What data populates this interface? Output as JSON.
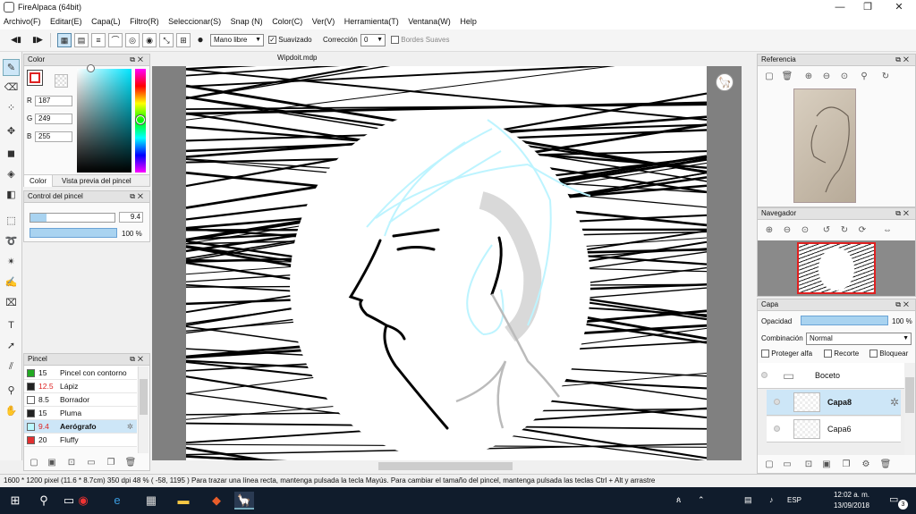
{
  "window": {
    "title": "FireAlpaca (64bit)",
    "minimize": "—",
    "restore": "❐",
    "close": "✕"
  },
  "menu": [
    "Archivo(F)",
    "Editar(E)",
    "Capa(L)",
    "Filtro(R)",
    "Seleccionar(S)",
    "Snap (N)",
    "Color(C)",
    "Ver(V)",
    "Herramienta(T)",
    "Ventana(W)",
    "Help"
  ],
  "toolbar": {
    "brush_mode": "Mano libre",
    "smoothing_label": "Suavizado",
    "correction_label": "Corrección",
    "correction_value": "0",
    "soft_edges_label": "Bordes Suaves"
  },
  "color_panel": {
    "title": "Color",
    "r_label": "R",
    "r_value": "187",
    "g_label": "G",
    "g_value": "249",
    "b_label": "B",
    "b_value": "255",
    "tab_color": "Color",
    "tab_preview": "Vista previa del pincel",
    "fg_color": "#bbf9ff"
  },
  "brush_control": {
    "title": "Control del pincel",
    "size_value": "9.4",
    "size_fraction": 0.19,
    "opacity_value": "100 %",
    "opacity_fraction": 1.0
  },
  "brush_panel": {
    "title": "Pincel",
    "brushes": [
      {
        "size": "15",
        "name": "Pincel con contorno",
        "color": "#22aa22",
        "red": false,
        "selected": false
      },
      {
        "size": "12.5",
        "name": "Lápiz",
        "color": "#222222",
        "red": true,
        "selected": false
      },
      {
        "size": "8.5",
        "name": "Borrador",
        "color": "#ffffff",
        "red": false,
        "selected": false
      },
      {
        "size": "15",
        "name": "Pluma",
        "color": "#222222",
        "red": false,
        "selected": false
      },
      {
        "size": "9.4",
        "name": "Aerógrafo",
        "color": "#bbf9ff",
        "red": true,
        "selected": true
      },
      {
        "size": "20",
        "name": "Fluffy",
        "color": "#e23030",
        "red": false,
        "selected": false
      }
    ]
  },
  "document": {
    "tab_name": "Wipdoit.mdp"
  },
  "reference_panel": {
    "title": "Referencia"
  },
  "navigator_panel": {
    "title": "Navegador"
  },
  "layer_panel": {
    "title": "Capa",
    "opacity_label": "Opacidad",
    "opacity_value": "100 %",
    "opacity_fraction": 1.0,
    "blend_label": "Combinación",
    "blend_value": "Normal",
    "protect_alpha": "Proteger alfa",
    "clip": "Recorte",
    "lock": "Bloquear",
    "layers": [
      {
        "name": "Boceto",
        "folder": true,
        "selected": false
      },
      {
        "name": "Capa8",
        "folder": false,
        "selected": true
      },
      {
        "name": "Capa6",
        "folder": false,
        "selected": false
      }
    ]
  },
  "status": {
    "text": "1600 * 1200 pixel   (11.6 * 8.7cm)   350 dpi   48 %   ( -58, 1195 )   Para trazar una línea recta, mantenga pulsada la tecla Mayús. Para cambiar el tamaño del pincel, mantenga pulsada las teclas Ctrl + Alt y arrastre"
  },
  "taskbar": {
    "lang": "ESP",
    "time": "12:02 a. m.",
    "date": "13/09/2018",
    "notification_count": "3"
  }
}
